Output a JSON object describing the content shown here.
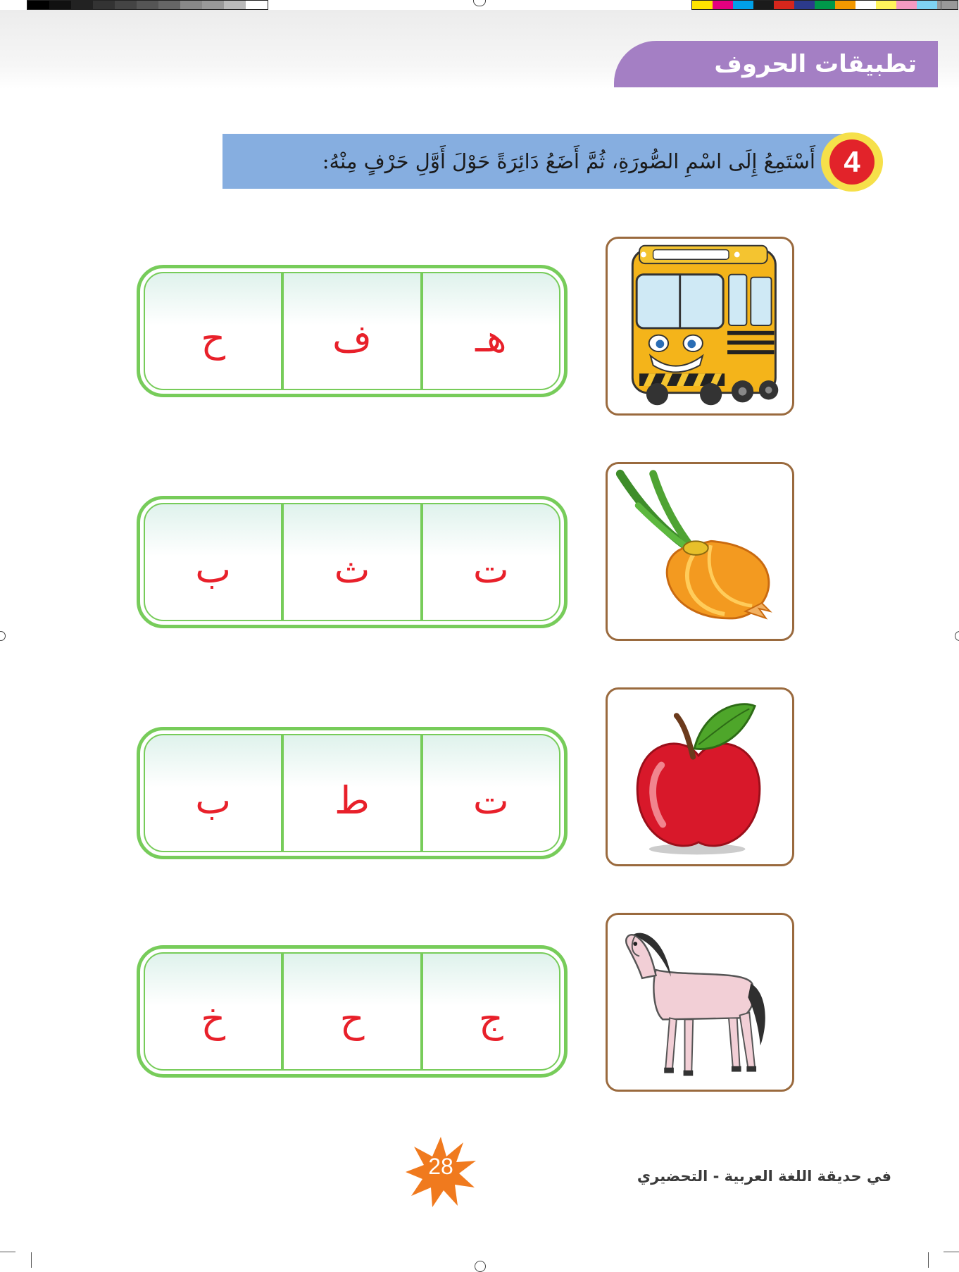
{
  "header": {
    "title": "تطبيقات الحروف"
  },
  "exercise": {
    "number": "4",
    "instruction": "أَسْتَمِعُ إِلَى اسْمِ الصُّورَةِ، ثُمَّ أَضَعُ دَائِرَةً حَوْلَ أَوَّلِ حَرْفٍ مِنْهُ:",
    "items": [
      {
        "picture": "bus-picture",
        "letters": [
          "ح",
          "ف",
          "هـ"
        ]
      },
      {
        "picture": "onion-picture",
        "letters": [
          "ب",
          "ث",
          "ت"
        ]
      },
      {
        "picture": "apple-picture",
        "letters": [
          "ب",
          "ط",
          "ت"
        ]
      },
      {
        "picture": "horse-picture",
        "letters": [
          "خ",
          "ح",
          "ج"
        ]
      }
    ]
  },
  "footer": {
    "page_number": "28",
    "book_title": "في حديقة اللغة العربية - التحضيري"
  },
  "colors": {
    "title_tab": "#a47fc4",
    "instruction_bar": "#86aee0",
    "badge_red": "#e2232a",
    "badge_yellow": "#f6e04a",
    "letter_red": "#e8202a",
    "box_green": "#77cc5a",
    "card_border": "#9a6a3e",
    "star_orange": "#f07a1e"
  }
}
